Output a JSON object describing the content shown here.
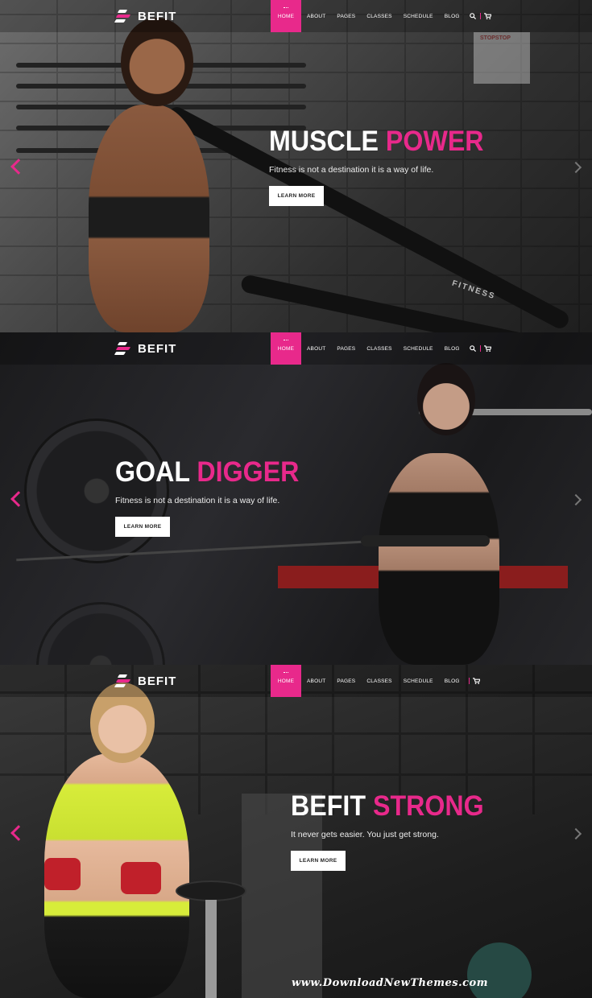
{
  "brand": {
    "name": "BEFIT",
    "logo_icon": "befit-bolt-logo-icon"
  },
  "nav": {
    "items": [
      "HOME",
      "ABOUT",
      "PAGES",
      "CLASSES",
      "SCHEDULE",
      "BLOG"
    ],
    "active": "HOME",
    "search_icon": "search-icon",
    "cart_icon": "cart-icon"
  },
  "slides": [
    {
      "title_main": "MUSCLE",
      "title_accent": "POWER",
      "subtitle": "Fitness is not a destination it is a way of life.",
      "button": "LEARN MORE"
    },
    {
      "title_main": "GOAL",
      "title_accent": "DIGGER",
      "subtitle": "Fitness is not a destination it is a way of life.",
      "button": "LEARN MORE"
    },
    {
      "title_main": "BEFIT",
      "title_accent": "STRONG",
      "subtitle": "It never gets easier. You just get strong.",
      "button": "LEARN MORE"
    }
  ],
  "scene_text": {
    "rope_label": "FITNESS",
    "sign_label": "STOPSTOP"
  },
  "colors": {
    "accent": "#e8298b",
    "button_bg": "#ffffff",
    "button_text": "#222222"
  },
  "watermark": "www.DownloadNewThemes.com"
}
